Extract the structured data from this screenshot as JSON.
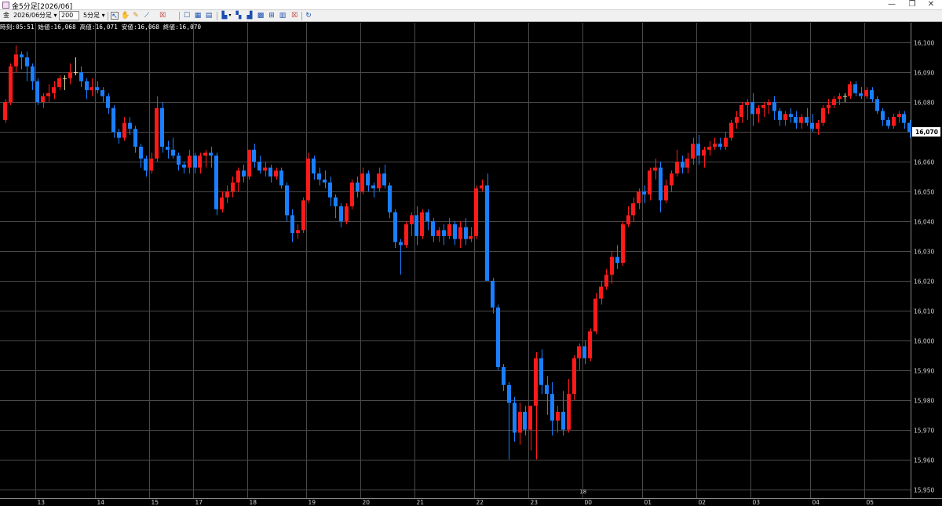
{
  "window": {
    "title": "金5分足[2026/06]",
    "minimize_glyph": "—",
    "maximize_glyph": "❐",
    "close_glyph": "✕"
  },
  "toolbar": {
    "symbol": "金",
    "contract_month": "2026/06",
    "interval_unit": "分足",
    "count_value": "200",
    "interval_select": "5分足",
    "icons": [
      "select-cursor-icon",
      "hand-icon",
      "pen-icon",
      "trendline-icon",
      "close-box-icon",
      "window-icon",
      "grid-icon",
      "table-icon",
      "bar-chart-icon",
      "indicator-icon",
      "compare-icon",
      "settings-icon",
      "zoom-icon",
      "close-box-icon",
      "refresh-icon"
    ]
  },
  "info": {
    "time_label": "時刻:",
    "time": "05:51",
    "open_label": "始値:",
    "open": "16,068",
    "high_label": "高値:",
    "high": "16,071",
    "low_label": "安値:",
    "low": "16,068",
    "close_label": "終値:",
    "close": "16,070"
  },
  "chart_data": {
    "type": "candlestick",
    "x_labels": [
      {
        "label": "13",
        "index": 6
      },
      {
        "label": "14",
        "index": 17
      },
      {
        "label": "15",
        "index": 27
      },
      {
        "label": "17",
        "index": 35
      },
      {
        "label": "18",
        "index": 45
      },
      {
        "label": "19",
        "index": 56
      },
      {
        "label": "20",
        "index": 66
      },
      {
        "label": "21",
        "index": 76
      },
      {
        "label": "22",
        "index": 87
      },
      {
        "label": "23",
        "index": 97
      },
      {
        "label": "00",
        "index": 107
      },
      {
        "label": "01",
        "index": 118
      },
      {
        "label": "02",
        "index": 128
      },
      {
        "label": "03",
        "index": 138
      },
      {
        "label": "04",
        "index": 149
      },
      {
        "label": "05",
        "index": 159
      }
    ],
    "month_marker": {
      "label": "18",
      "index": 107
    },
    "y_ticks": [
      15950,
      15960,
      15970,
      15980,
      15990,
      16000,
      16010,
      16020,
      16030,
      16040,
      16050,
      16060,
      16070,
      16080,
      16090,
      16100
    ],
    "y_tick_labels": [
      "15,950",
      "15,960",
      "15,970",
      "15,980",
      "15,990",
      "16,000",
      "16,010",
      "16,020",
      "16,030",
      "16,040",
      "16,050",
      "16,060",
      "16,070",
      "16,080",
      "16,090",
      "16,100"
    ],
    "ylim": [
      15947,
      16104
    ],
    "last_price_label": "16,070",
    "last_price": 16070,
    "colors": {
      "up": "#ff1a1a",
      "down": "#1a7fff",
      "doji": "#e8e0a0",
      "grid": "#4a4a4a",
      "axis_text": "#cfcfcf"
    },
    "ohlc": [
      [
        16074,
        16081,
        16073,
        16080
      ],
      [
        16080,
        16093,
        16079,
        16092
      ],
      [
        16092,
        16099,
        16090,
        16096
      ],
      [
        16096,
        16097,
        16091,
        16095
      ],
      [
        16095,
        16097,
        16087,
        16092
      ],
      [
        16092,
        16093,
        16084,
        16087
      ],
      [
        16087,
        16088,
        16079,
        16080
      ],
      [
        16080,
        16083,
        16078,
        16082
      ],
      [
        16082,
        16086,
        16080,
        16083
      ],
      [
        16083,
        16087,
        16081,
        16085
      ],
      [
        16085,
        16089,
        16084,
        16088
      ],
      [
        16088,
        16089,
        16084,
        16088
      ],
      [
        16088,
        16093,
        16086,
        16090
      ],
      [
        16090,
        16095,
        16089,
        16090
      ],
      [
        16090,
        16092,
        16085,
        16087
      ],
      [
        16087,
        16088,
        16081,
        16084
      ],
      [
        16084,
        16088,
        16082,
        16085
      ],
      [
        16085,
        16087,
        16083,
        16084
      ],
      [
        16084,
        16085,
        16080,
        16082
      ],
      [
        16082,
        16083,
        16076,
        16078
      ],
      [
        16078,
        16079,
        16068,
        16070
      ],
      [
        16070,
        16071,
        16066,
        16068
      ],
      [
        16068,
        16075,
        16067,
        16073
      ],
      [
        16073,
        16075,
        16069,
        16071
      ],
      [
        16071,
        16072,
        16063,
        16065
      ],
      [
        16065,
        16066,
        16058,
        16061
      ],
      [
        16061,
        16062,
        16055,
        16057
      ],
      [
        16057,
        16063,
        16056,
        16061
      ],
      [
        16061,
        16082,
        16060,
        16078
      ],
      [
        16078,
        16080,
        16063,
        16065
      ],
      [
        16065,
        16067,
        16061,
        16064
      ],
      [
        16064,
        16068,
        16061,
        16062
      ],
      [
        16062,
        16063,
        16057,
        16059
      ],
      [
        16059,
        16060,
        16056,
        16058
      ],
      [
        16058,
        16064,
        16056,
        16062
      ],
      [
        16062,
        16063,
        16056,
        16058
      ],
      [
        16058,
        16063,
        16056,
        16062
      ],
      [
        16062,
        16064,
        16058,
        16063
      ],
      [
        16063,
        16065,
        16058,
        16062
      ],
      [
        16062,
        16063,
        16042,
        16044
      ],
      [
        16044,
        16050,
        16043,
        16048
      ],
      [
        16048,
        16052,
        16046,
        16050
      ],
      [
        16050,
        16055,
        16048,
        16053
      ],
      [
        16053,
        16058,
        16050,
        16057
      ],
      [
        16057,
        16059,
        16053,
        16055
      ],
      [
        16055,
        16064,
        16054,
        16064
      ],
      [
        16064,
        16066,
        16058,
        16060
      ],
      [
        16060,
        16062,
        16056,
        16057
      ],
      [
        16057,
        16060,
        16055,
        16058
      ],
      [
        16058,
        16059,
        16053,
        16055
      ],
      [
        16055,
        16058,
        16054,
        16057
      ],
      [
        16057,
        16058,
        16051,
        16052
      ],
      [
        16052,
        16053,
        16040,
        16042
      ],
      [
        16042,
        16044,
        16033,
        16036
      ],
      [
        16036,
        16039,
        16034,
        16037
      ],
      [
        16037,
        16048,
        16036,
        16047
      ],
      [
        16047,
        16063,
        16046,
        16061
      ],
      [
        16061,
        16062,
        16054,
        16056
      ],
      [
        16056,
        16058,
        16052,
        16054
      ],
      [
        16054,
        16057,
        16051,
        16053
      ],
      [
        16053,
        16055,
        16045,
        16048
      ],
      [
        16048,
        16049,
        16041,
        16045
      ],
      [
        16045,
        16046,
        16038,
        16040
      ],
      [
        16040,
        16046,
        16039,
        16045
      ],
      [
        16045,
        16054,
        16044,
        16053
      ],
      [
        16053,
        16055,
        16048,
        16050
      ],
      [
        16050,
        16058,
        16049,
        16056
      ],
      [
        16056,
        16057,
        16050,
        16052
      ],
      [
        16052,
        16053,
        16048,
        16051
      ],
      [
        16051,
        16058,
        16050,
        16056
      ],
      [
        16056,
        16059,
        16051,
        16052
      ],
      [
        16052,
        16053,
        16041,
        16043
      ],
      [
        16043,
        16044,
        16031,
        16033
      ],
      [
        16033,
        16034,
        16022,
        16032
      ],
      [
        16032,
        16040,
        16031,
        16039
      ],
      [
        16039,
        16043,
        16035,
        16042
      ],
      [
        16042,
        16045,
        16032,
        16035
      ],
      [
        16035,
        16044,
        16034,
        16043
      ],
      [
        16043,
        16044,
        16037,
        16040
      ],
      [
        16040,
        16041,
        16033,
        16035
      ],
      [
        16035,
        16038,
        16033,
        16037
      ],
      [
        16037,
        16039,
        16032,
        16035
      ],
      [
        16035,
        16041,
        16034,
        16039
      ],
      [
        16039,
        16040,
        16032,
        16034
      ],
      [
        16034,
        16040,
        16031,
        16038
      ],
      [
        16038,
        16041,
        16032,
        16034
      ],
      [
        16034,
        16038,
        16033,
        16035
      ],
      [
        16035,
        16052,
        16034,
        16051
      ],
      [
        16051,
        16054,
        16050,
        16052
      ],
      [
        16052,
        16056,
        16022,
        16020
      ],
      [
        16020,
        16021,
        16009,
        16011
      ],
      [
        16011,
        16012,
        15990,
        15991
      ],
      [
        15991,
        15992,
        15983,
        15985
      ],
      [
        15985,
        15986,
        15960,
        15979
      ],
      [
        15979,
        15981,
        15966,
        15969
      ],
      [
        15969,
        15979,
        15965,
        15976
      ],
      [
        15976,
        15978,
        15968,
        15970
      ],
      [
        15970,
        15976,
        15963,
        15978
      ],
      [
        15978,
        15996,
        15960,
        15994
      ],
      [
        15994,
        15997,
        15982,
        15985
      ],
      [
        15985,
        15988,
        15975,
        15982
      ],
      [
        15982,
        15986,
        15968,
        15973
      ],
      [
        15973,
        15978,
        15969,
        15976
      ],
      [
        15976,
        15983,
        15968,
        15970
      ],
      [
        15970,
        15987,
        15969,
        15982
      ],
      [
        15982,
        15995,
        15980,
        15994
      ],
      [
        15994,
        15999,
        15990,
        15998
      ],
      [
        15998,
        16000,
        15992,
        15994
      ],
      [
        15994,
        16004,
        15993,
        16003
      ],
      [
        16003,
        16016,
        16002,
        16014
      ],
      [
        16014,
        16020,
        16012,
        16018
      ],
      [
        16018,
        16024,
        16017,
        16022
      ],
      [
        16022,
        16030,
        16019,
        16028
      ],
      [
        16028,
        16032,
        16024,
        16026
      ],
      [
        16026,
        16040,
        16025,
        16039
      ],
      [
        16039,
        16045,
        16038,
        16042
      ],
      [
        16042,
        16048,
        16040,
        16046
      ],
      [
        16046,
        16051,
        16044,
        16050
      ],
      [
        16050,
        16052,
        16046,
        16049
      ],
      [
        16049,
        16058,
        16047,
        16057
      ],
      [
        16057,
        16061,
        16054,
        16058
      ],
      [
        16058,
        16060,
        16043,
        16047
      ],
      [
        16047,
        16054,
        16046,
        16052
      ],
      [
        16052,
        16057,
        16050,
        16056
      ],
      [
        16056,
        16064,
        16055,
        16060
      ],
      [
        16060,
        16062,
        16056,
        16058
      ],
      [
        16058,
        16063,
        16056,
        16061
      ],
      [
        16061,
        16068,
        16059,
        16066
      ],
      [
        16066,
        16069,
        16059,
        16062
      ],
      [
        16062,
        16065,
        16058,
        16064
      ],
      [
        16064,
        16067,
        16062,
        16065
      ],
      [
        16065,
        16068,
        16064,
        16066
      ],
      [
        16066,
        16068,
        16064,
        16065
      ],
      [
        16065,
        16070,
        16064,
        16068
      ],
      [
        16068,
        16074,
        16067,
        16073
      ],
      [
        16073,
        16077,
        16071,
        16075
      ],
      [
        16075,
        16080,
        16073,
        16079
      ],
      [
        16079,
        16081,
        16074,
        16080
      ],
      [
        16080,
        16083,
        16072,
        16076
      ],
      [
        16076,
        16079,
        16073,
        16078
      ],
      [
        16078,
        16080,
        16075,
        16079
      ],
      [
        16079,
        16081,
        16076,
        16080
      ],
      [
        16080,
        16082,
        16074,
        16077
      ],
      [
        16077,
        16078,
        16072,
        16074
      ],
      [
        16074,
        16077,
        16072,
        16076
      ],
      [
        16076,
        16078,
        16073,
        16075
      ],
      [
        16075,
        16077,
        16071,
        16073
      ],
      [
        16073,
        16076,
        16071,
        16075
      ],
      [
        16075,
        16078,
        16072,
        16073
      ],
      [
        16073,
        16076,
        16070,
        16071
      ],
      [
        16071,
        16074,
        16069,
        16073
      ],
      [
        16073,
        16079,
        16072,
        16078
      ],
      [
        16078,
        16081,
        16076,
        16079
      ],
      [
        16079,
        16082,
        16078,
        16081
      ],
      [
        16081,
        16083,
        16079,
        16082
      ],
      [
        16082,
        16083,
        16080,
        16082
      ],
      [
        16082,
        16087,
        16081,
        16086
      ],
      [
        16086,
        16087,
        16082,
        16083
      ],
      [
        16083,
        16085,
        16081,
        16082
      ],
      [
        16082,
        16085,
        16081,
        16084
      ],
      [
        16084,
        16085,
        16080,
        16081
      ],
      [
        16081,
        16082,
        16076,
        16077
      ],
      [
        16077,
        16078,
        16072,
        16074
      ],
      [
        16074,
        16075,
        16071,
        16072
      ],
      [
        16072,
        16076,
        16071,
        16075
      ],
      [
        16075,
        16077,
        16073,
        16076
      ],
      [
        16076,
        16077,
        16071,
        16073
      ],
      [
        16073,
        16074,
        16068,
        16070
      ]
    ]
  }
}
